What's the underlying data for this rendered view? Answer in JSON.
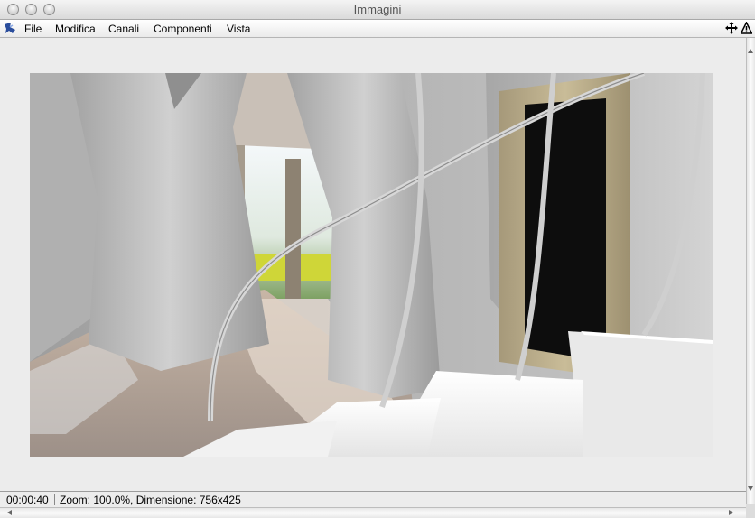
{
  "window": {
    "title": "Immagini"
  },
  "menubar": {
    "items": [
      {
        "label": "File"
      },
      {
        "label": "Modifica"
      },
      {
        "label": "Canali"
      },
      {
        "label": "Componenti"
      },
      {
        "label": "Vista"
      }
    ],
    "right_icons": [
      "move-icon",
      "warning-icon"
    ]
  },
  "render": {
    "icon": "rendered-interior-image"
  },
  "statusbar": {
    "time": "00:00:40",
    "info": "Zoom: 100.0%, Dimensione: 756x425"
  }
}
